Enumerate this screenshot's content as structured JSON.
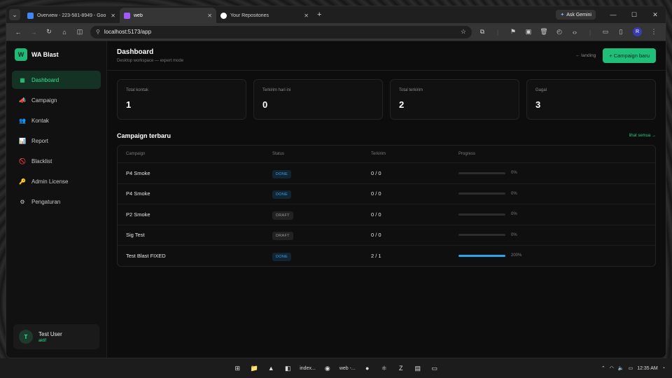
{
  "browser": {
    "tabs": [
      {
        "title": "Overview - 223-581-8949 - Goo",
        "active": false,
        "favicon": "google-ads-icon",
        "color": "#4285f4"
      },
      {
        "title": "web",
        "active": true,
        "favicon": "vite-icon",
        "color": "#a259ff"
      },
      {
        "title": "Your Repositories",
        "active": false,
        "favicon": "github-icon",
        "color": "#ffffff"
      }
    ],
    "ask_gemini": "Ask Gemini",
    "url": "localhost:5173/app",
    "profile_initial": "R"
  },
  "app": {
    "brand": {
      "logo": "W",
      "name": "WA Blast",
      "accent": "#1fb978"
    },
    "nav": [
      {
        "label": "Dashboard",
        "icon": "dashboard-icon",
        "glyph": "▦",
        "active": true
      },
      {
        "label": "Campaign",
        "icon": "megaphone-icon",
        "glyph": "📣",
        "active": false
      },
      {
        "label": "Kontak",
        "icon": "contacts-icon",
        "glyph": "👥",
        "active": false
      },
      {
        "label": "Report",
        "icon": "report-icon",
        "glyph": "📊",
        "active": false
      },
      {
        "label": "Blacklist",
        "icon": "blacklist-icon",
        "glyph": "🚫",
        "active": false
      },
      {
        "label": "Admin License",
        "icon": "key-icon",
        "glyph": "🔑",
        "active": false
      },
      {
        "label": "Pengaturan",
        "icon": "settings-icon",
        "glyph": "⚙",
        "active": false
      }
    ],
    "user": {
      "initial": "T",
      "name": "Test User",
      "status": "aktif"
    },
    "header": {
      "title": "Dashboard",
      "subtitle": "Desktop workspace — expert mode",
      "landing_link": "← landing",
      "new_campaign": "+ Campaign baru"
    },
    "stats": [
      {
        "label": "Total kontak",
        "value": "1"
      },
      {
        "label": "Terkirim hari ini",
        "value": "0"
      },
      {
        "label": "Total terkirim",
        "value": "2"
      },
      {
        "label": "Gagal",
        "value": "3"
      }
    ],
    "recent": {
      "title": "Campaign terbaru",
      "see_all": "lihat semua →",
      "columns": [
        "Campaign",
        "Status",
        "Terkirim",
        "Progress"
      ],
      "rows": [
        {
          "name": "P4 Smoke",
          "status": "DONE",
          "status_kind": "done",
          "sent": "0 / 0",
          "progress": 0,
          "progress_label": "0%"
        },
        {
          "name": "P4 Smoke",
          "status": "DONE",
          "status_kind": "done",
          "sent": "0 / 0",
          "progress": 0,
          "progress_label": "0%"
        },
        {
          "name": "P2 Smoke",
          "status": "DRAFT",
          "status_kind": "draft",
          "sent": "0 / 0",
          "progress": 0,
          "progress_label": "0%"
        },
        {
          "name": "Sig Test",
          "status": "DRAFT",
          "status_kind": "draft",
          "sent": "0 / 0",
          "progress": 0,
          "progress_label": "0%"
        },
        {
          "name": "Test Blast FIXED",
          "status": "DONE",
          "status_kind": "done",
          "sent": "2 / 1",
          "progress": 1,
          "progress_label": "200%"
        }
      ]
    }
  },
  "taskbar": {
    "apps": [
      {
        "icon": "windows-start-icon",
        "glyph": "⊞"
      },
      {
        "icon": "file-explorer-icon",
        "glyph": "📁"
      },
      {
        "icon": "terminal-icon",
        "glyph": "▲"
      },
      {
        "icon": "vscode-icon",
        "glyph": "◧"
      },
      {
        "icon": "chrome-icon",
        "glyph": "◉"
      },
      {
        "icon": "postman-icon",
        "glyph": "●"
      },
      {
        "icon": "react-icon",
        "glyph": "⚛"
      },
      {
        "icon": "filezilla-icon",
        "glyph": "Z"
      },
      {
        "icon": "notes-icon",
        "glyph": "▤"
      },
      {
        "icon": "cmd-icon",
        "glyph": "▭"
      }
    ],
    "window_labels": [
      "index...",
      "web -..."
    ],
    "time": "12:35 AM"
  }
}
